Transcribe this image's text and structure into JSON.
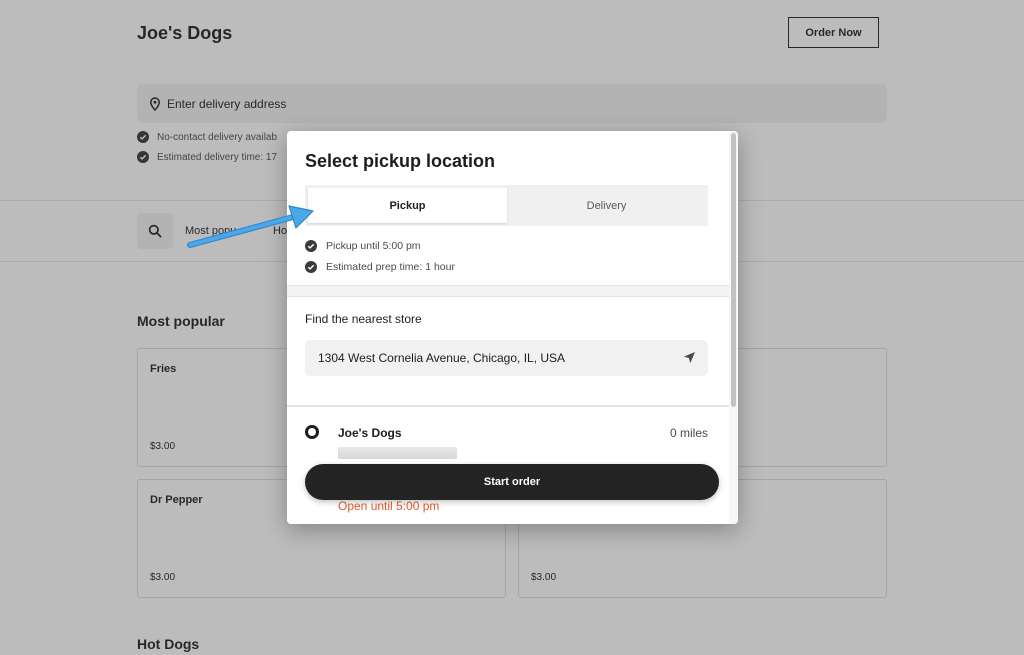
{
  "header": {
    "store_name": "Joe's Dogs",
    "order_now": "Order Now"
  },
  "delivery": {
    "address_placeholder": "Enter delivery address",
    "info": [
      "No-contact delivery availab",
      "Estimated delivery time: 17"
    ]
  },
  "nav": {
    "items": [
      "Most popu",
      "Ho"
    ]
  },
  "sections": {
    "most_popular": "Most popular",
    "hot_dogs": "Hot Dogs"
  },
  "cards": [
    {
      "name": "Fries",
      "price": "$3.00"
    },
    {
      "name": "Dr Pepper",
      "price": "$3.00"
    },
    {
      "name": "",
      "price": "$3.00"
    }
  ],
  "modal": {
    "title": "Select pickup location",
    "tabs": [
      "Pickup",
      "Delivery"
    ],
    "active_tab": "Pickup",
    "info": [
      "Pickup until 5:00 pm",
      "Estimated prep time: 1 hour"
    ],
    "find_label": "Find the nearest store",
    "store_input_value": "1304 West Cornelia Avenue, Chicago, IL, USA",
    "location": {
      "name": "Joe's Dogs",
      "distance": "0 miles",
      "status": "Open until 5:00 pm"
    },
    "start_button": "Start order"
  },
  "icons": {
    "location_pin": "map-pin-icon",
    "check": "check-circle-icon",
    "search": "search-icon",
    "geolocate": "navigation-arrow-icon"
  },
  "colors": {
    "accent_open": "#e4572e",
    "button_dark": "#242424",
    "annotation_arrow": "#4aa8e8"
  }
}
